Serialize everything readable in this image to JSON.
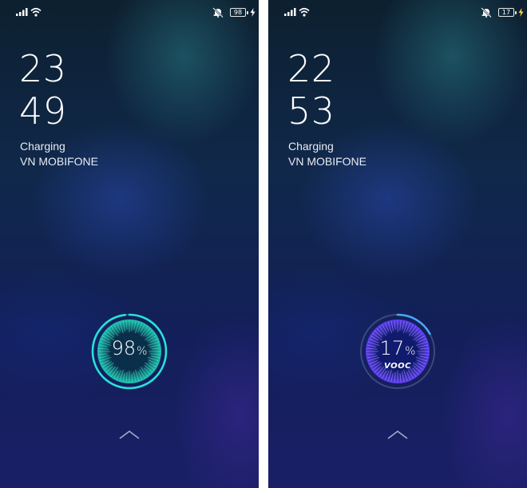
{
  "screens": [
    {
      "id": "left",
      "status_bar": {
        "battery_level": "98",
        "icons": [
          "signal-icon",
          "wifi-icon",
          "mute-icon",
          "battery-icon",
          "bolt-icon"
        ]
      },
      "clock": {
        "hour": "23",
        "minute": "49"
      },
      "status_line": "Charging",
      "carrier": "VN MOBIFONE",
      "charge": {
        "percent_number": "98",
        "percent_symbol": "%",
        "fill_fraction": 0.98,
        "badge": ""
      },
      "theme_colors": {
        "ring": "#27e3d6",
        "core_outer": "#1cc4b0",
        "core_inner": "#0b2f4a",
        "ray": "#5ff5df"
      }
    },
    {
      "id": "right",
      "status_bar": {
        "battery_level": "17",
        "icons": [
          "signal-icon",
          "wifi-icon",
          "mute-icon",
          "battery-icon",
          "bolt-icon"
        ]
      },
      "clock": {
        "hour": "22",
        "minute": "53"
      },
      "status_line": "Charging",
      "carrier": "VN MOBIFONE",
      "charge": {
        "percent_number": "17",
        "percent_symbol": "%",
        "fill_fraction": 0.17,
        "badge": "VOOC"
      },
      "theme_colors": {
        "ring": "#4aa8ff",
        "core_outer": "#5b3cf0",
        "core_inner": "#101b6e",
        "ray": "#b9a8ff"
      }
    }
  ],
  "accent": {
    "bolt": "#ffd54a"
  }
}
